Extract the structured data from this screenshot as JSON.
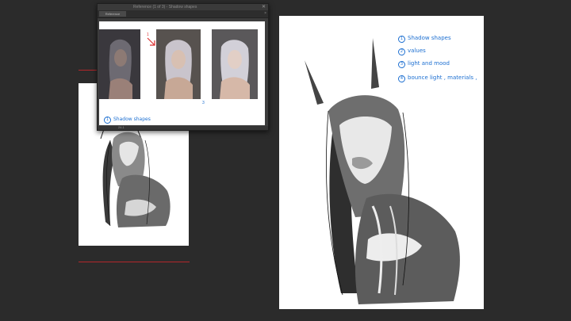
{
  "reference_window": {
    "title": "Reference (1 of 3) - Shadow shapes",
    "tab_label": "Reference",
    "zoom": "24.1",
    "caption_number": "1",
    "caption_text": "Shadow shapes",
    "step_markers": [
      "1",
      "3"
    ]
  },
  "notes": [
    {
      "number": "1",
      "text": "Shadow shapes"
    },
    {
      "number": "2",
      "text": "values"
    },
    {
      "number": "3",
      "text": "light and mood"
    },
    {
      "number": "4",
      "text": "bounce light , materials ,"
    }
  ],
  "colors": {
    "background": "#2b2b2b",
    "annotation_blue": "#1c6fd1",
    "guide_red": "#b3262a"
  }
}
